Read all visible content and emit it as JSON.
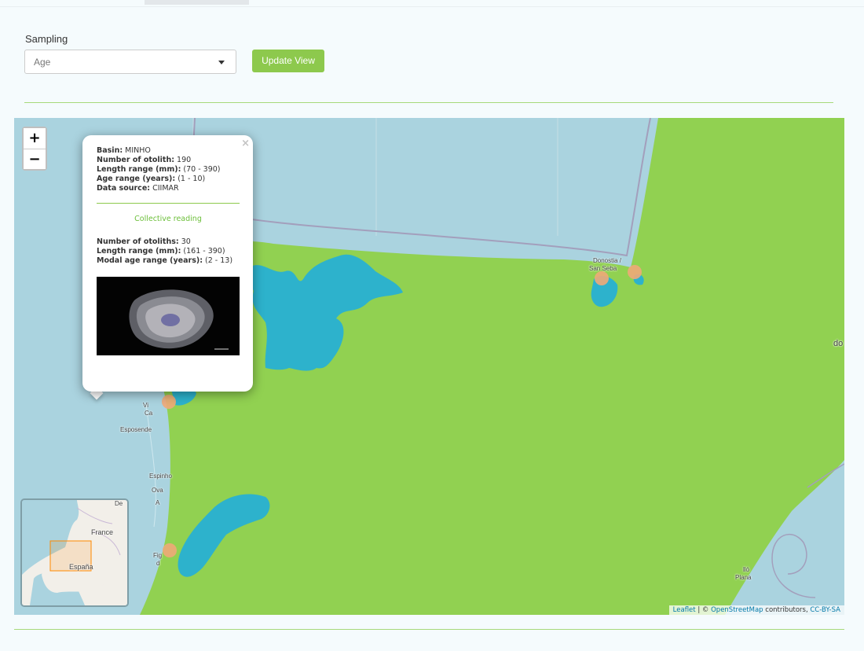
{
  "controls": {
    "sampling_label": "Sampling",
    "sampling_value": "Age",
    "update_button": "Update View"
  },
  "map": {
    "zoom_in": "+",
    "zoom_out": "−",
    "place_labels": {
      "donostia_1": "Donostia /",
      "donostia_2": "San Seba",
      "viana_1": "Vi",
      "viana_2": "Ca",
      "esposende": "Esposende",
      "espinho": "Espinho",
      "ovar": "Ova",
      "aveiro": "A",
      "figueira_1": "Fig",
      "figueira_2": "d",
      "plana_1": "lló",
      "plana_2": "Plana",
      "edge": "do"
    },
    "attribution": {
      "leaflet": "Leaflet",
      "sep": " | © ",
      "osm": "OpenStreetMap",
      "contrib": " contributors, ",
      "license": "CC-BY-SA"
    },
    "minimap_labels": {
      "france": "France",
      "espana": "España",
      "de": "De"
    },
    "colors": {
      "water": "#aad3df",
      "land": "#91d151",
      "basin": "#2db2cc",
      "marker": "#f0a878"
    }
  },
  "popup": {
    "close": "×",
    "basin_label": "Basin:",
    "basin_value": " MINHO",
    "otolith_label": "Number of otolith:",
    "otolith_value": " 190",
    "length_label": "Length range (mm):",
    "length_value": " (70 - 390)",
    "age_label": "Age range (years):",
    "age_value": " (1 - 10)",
    "source_label": "Data source:",
    "source_value": " CIIMAR",
    "collective": "Collective reading",
    "otoliths2_label": "Number of otoliths:",
    "otoliths2_value": " 30",
    "length2_label": "Length range (mm):",
    "length2_value": " (161 - 390)",
    "modal_label": "Modal age range (years):",
    "modal_value": " (2 - 13)"
  }
}
